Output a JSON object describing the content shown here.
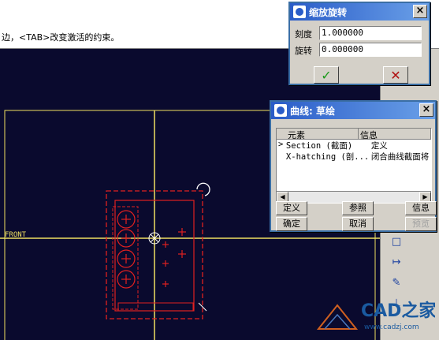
{
  "message": "边，<TAB>改变激活的约束。",
  "canvas": {
    "front_label": "FRONT",
    "bg_color": "#0a0a2e",
    "datum_color": "#f0e060",
    "sketch_color": "#e02020"
  },
  "zoom_dialog": {
    "title": "缩放旋转",
    "scale_label": "刻度",
    "scale_value": "1.000000",
    "rotate_label": "旋转",
    "rotate_value": "0.000000",
    "ok_icon": "check-icon",
    "cancel_icon": "x-icon"
  },
  "curve_dialog": {
    "title": "曲线: 草绘",
    "columns": [
      "元素",
      "信息"
    ],
    "rows": [
      {
        "marker": ">",
        "element": "Section (截面)",
        "info": "定义"
      },
      {
        "marker": "",
        "element": "X-hatching (剖...",
        "info": "闭合曲线截面将"
      }
    ],
    "buttons": {
      "define": "定义",
      "reference": "参照",
      "info": "信息",
      "confirm": "确定",
      "cancel": "取消",
      "preview": "预览"
    }
  },
  "watermark": {
    "brand": "CAD之家",
    "url": "www.cadzj.com"
  }
}
